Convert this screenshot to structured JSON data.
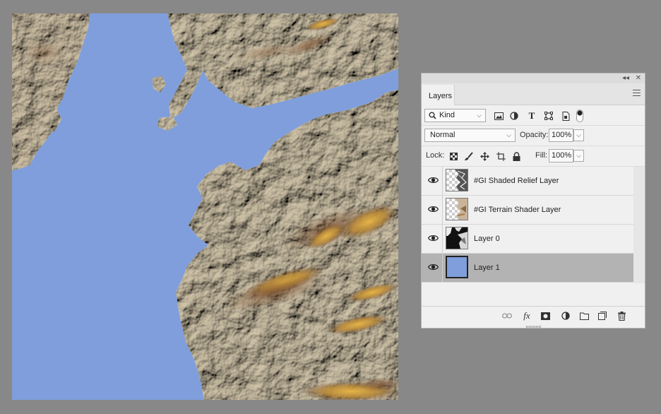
{
  "panel": {
    "tab_label": "Layers",
    "filter": {
      "selected": "Kind"
    },
    "blend_mode": {
      "selected": "Normal"
    },
    "opacity": {
      "label": "Opacity:",
      "value": "100%"
    },
    "lock": {
      "label": "Lock:"
    },
    "fill": {
      "label": "Fill:",
      "value": "100%"
    },
    "layers": [
      {
        "name": "#GI Shaded Relief Layer",
        "visible": true,
        "selected": false,
        "thumb": "relief"
      },
      {
        "name": "#GI Terrain Shader Layer",
        "visible": true,
        "selected": false,
        "thumb": "terrain"
      },
      {
        "name": "Layer 0",
        "visible": true,
        "selected": false,
        "thumb": "mask"
      },
      {
        "name": "Layer 1",
        "visible": true,
        "selected": true,
        "thumb": "blue"
      }
    ],
    "footer_icons": [
      "link-icon",
      "fx-icon",
      "mask-icon",
      "adjustment-icon",
      "folder-icon",
      "new-layer-icon",
      "trash-icon"
    ]
  },
  "colors": {
    "water": "#7f9edb",
    "land": "#ddd5c3",
    "highlight": "#e0b04a",
    "shadow": "#5a3a20",
    "selected_row": "#b3b3b3",
    "workspace": "#888888"
  }
}
